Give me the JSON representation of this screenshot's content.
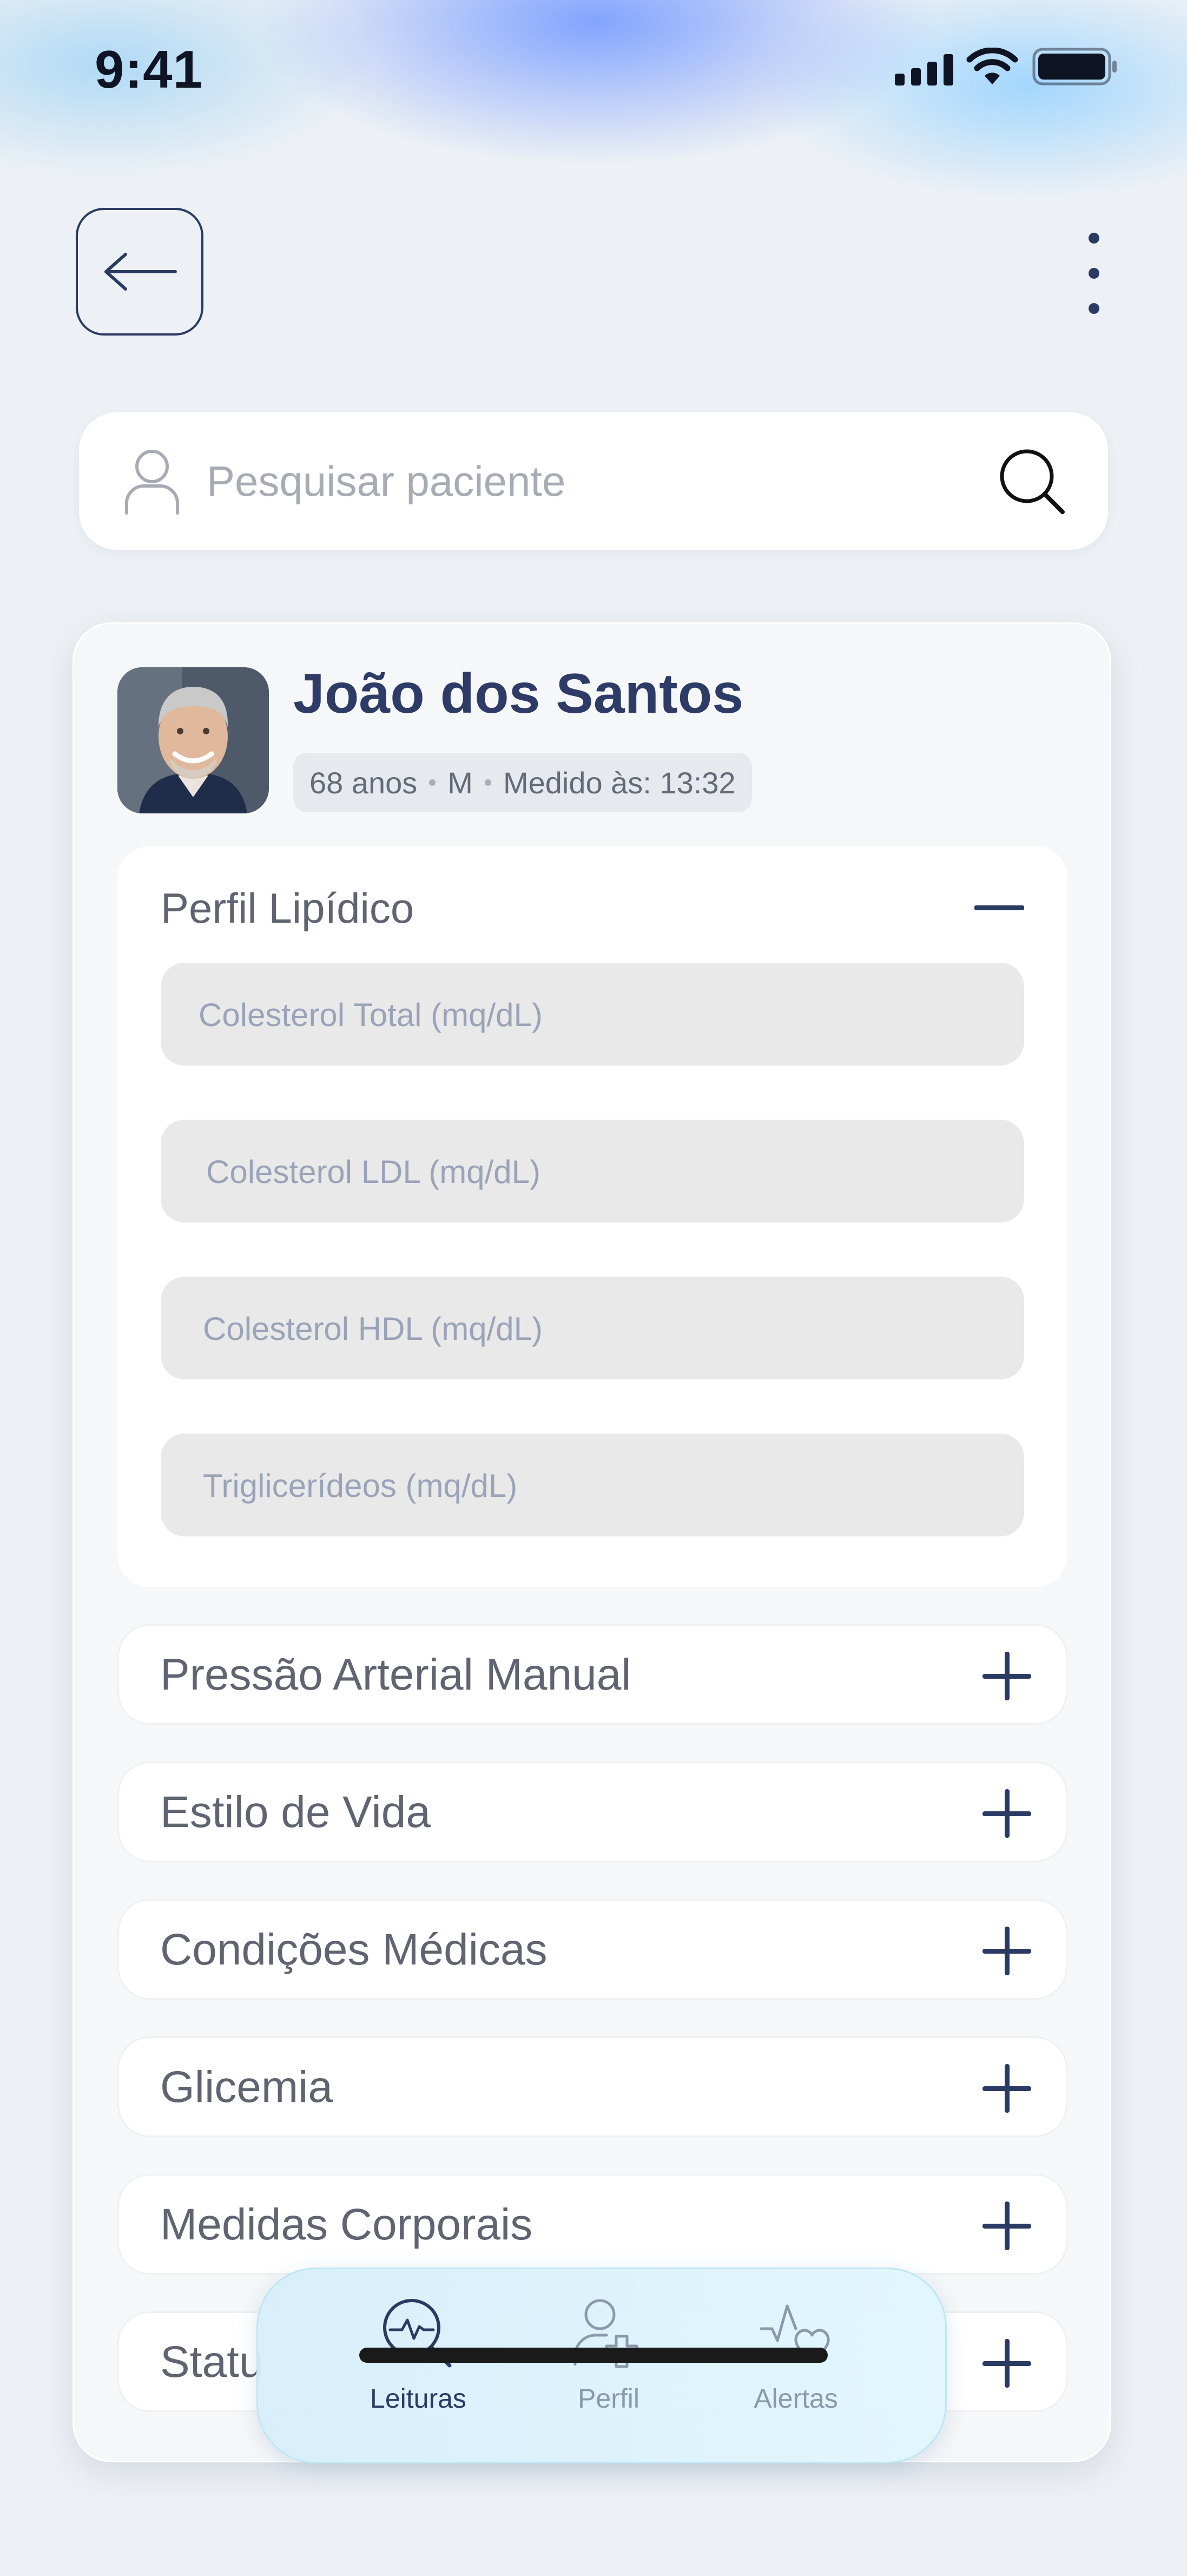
{
  "status_bar": {
    "time": "9:41"
  },
  "search": {
    "placeholder": "Pesquisar paciente"
  },
  "patient": {
    "name": "João dos Santos",
    "age": "68 anos",
    "sex": "M",
    "measured": "Medido às: 13:32"
  },
  "lipid_panel": {
    "title": "Perfil Lipídico",
    "fields": [
      {
        "placeholder": "Colesterol Total (mq/dL)"
      },
      {
        "placeholder": "Colesterol LDL (mq/dL)"
      },
      {
        "placeholder": "Colesterol HDL (mq/dL)"
      },
      {
        "placeholder": "Triglicerídeos (mq/dL)"
      }
    ]
  },
  "sections": [
    {
      "label": "Pressão Arterial Manual"
    },
    {
      "label": "Estilo de Vida"
    },
    {
      "label": "Condições Médicas"
    },
    {
      "label": "Glicemia"
    },
    {
      "label": "Medidas Corporais"
    },
    {
      "label": "Statu"
    }
  ],
  "tabbar": {
    "items": [
      {
        "label": "Leituras",
        "icon": "search-pulse-icon",
        "active": true
      },
      {
        "label": "Perfil",
        "icon": "user-plus-icon",
        "active": false
      },
      {
        "label": "Alertas",
        "icon": "heart-pulse-icon",
        "active": false
      }
    ]
  },
  "colors": {
    "accent": "#2e3b66",
    "muted_text": "#5f6470",
    "field_bg": "#e9e9ea",
    "tab_active": "#2b3a63",
    "tab_inactive": "#8a99ab"
  }
}
